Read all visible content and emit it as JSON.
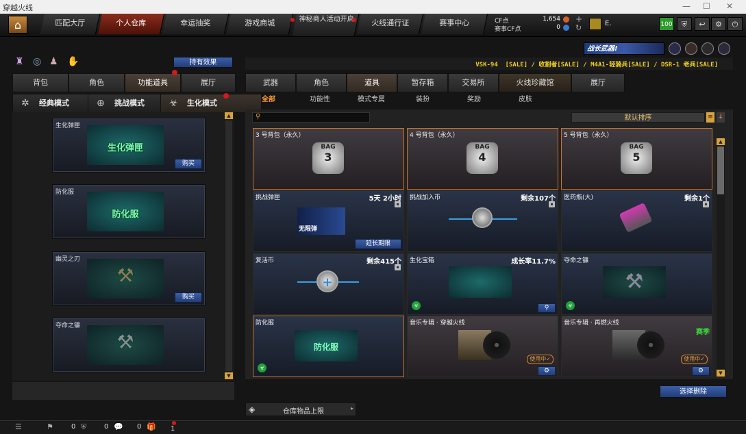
{
  "window": {
    "title": "穿越火线"
  },
  "nav": {
    "tabs": [
      {
        "label": "匹配大厅"
      },
      {
        "label": "个人仓库"
      },
      {
        "label": "幸运抽奖"
      },
      {
        "label": "游戏商城"
      },
      {
        "label": "神秘商人活动开启"
      },
      {
        "label": "火线通行证"
      },
      {
        "label": "赛事中心"
      }
    ],
    "cf_label": "CF点",
    "cf_value": "1,654",
    "match_cf_label": "赛事CF点",
    "match_cf_value": "0",
    "username": "E.",
    "level_badge": "100"
  },
  "left": {
    "effect_button": "持有效果",
    "tabs": [
      "背包",
      "角色",
      "功能道具",
      "展厅"
    ],
    "modes": [
      "经典模式",
      "挑战模式",
      "生化模式"
    ],
    "items": [
      {
        "name": "生化弹匣",
        "art_text": "生化弹匣",
        "buy": "购买"
      },
      {
        "name": "防化服",
        "art_text": "防化服",
        "buy": ""
      },
      {
        "name": "幽灵之刃",
        "art_text": "",
        "buy": "购买"
      },
      {
        "name": "夺命之镰",
        "art_text": "",
        "buy": ""
      }
    ],
    "icons": [
      "rank-icon",
      "refresh-icon",
      "character-icon",
      "bag-icon"
    ]
  },
  "right": {
    "banner": "战长武器!",
    "marquee": "VSK-94  [SALE] / 收割者[SALE] / M4A1-轻骑兵[SALE] / DSR-1 老兵[SALE]",
    "tabs": [
      "武器",
      "角色",
      "道具",
      "暂存箱",
      "交易所",
      "火线珍藏馆",
      "展厅"
    ],
    "subtabs": [
      "全部",
      "功能性",
      "模式专属",
      "装扮",
      "奖励",
      "皮肤"
    ],
    "sort_label": "默认排序",
    "items": [
      {
        "name": "3 号背包（永久）",
        "info": "",
        "bag": "3"
      },
      {
        "name": "4 号背包（永久）",
        "info": "",
        "bag": "4"
      },
      {
        "name": "5 号背包（永久）",
        "info": "",
        "bag": "5"
      },
      {
        "name": "挑战弹匣",
        "info": "5天 2小时",
        "action": "延长期限",
        "art": "无限弹"
      },
      {
        "name": "挑战加入币",
        "info": "剩余107个"
      },
      {
        "name": "医药瓶(大)",
        "info": "剩余1个"
      },
      {
        "name": "复活币",
        "info": "剩余415个"
      },
      {
        "name": "生化宝箱",
        "info": "成长率11.7%"
      },
      {
        "name": "夺命之镰",
        "info": ""
      },
      {
        "name": "防化服",
        "info": "",
        "art": "防化服"
      },
      {
        "name": "音乐专辑 · 穿越火线",
        "info": "",
        "status": "使用中✓"
      },
      {
        "name": "音乐专辑 · 再燃火线",
        "info": "赛季",
        "status": "使用中✓"
      }
    ],
    "select_delete": "选择删除",
    "storage_label": "仓库物品上限"
  },
  "status": {
    "values": [
      "0",
      "0",
      "0",
      "1"
    ]
  },
  "colors": {
    "accent": "#ff9b2e",
    "active_tab": "#8a2c1d",
    "button_blue": "#2e4d92",
    "marquee": "#f2d21d"
  }
}
